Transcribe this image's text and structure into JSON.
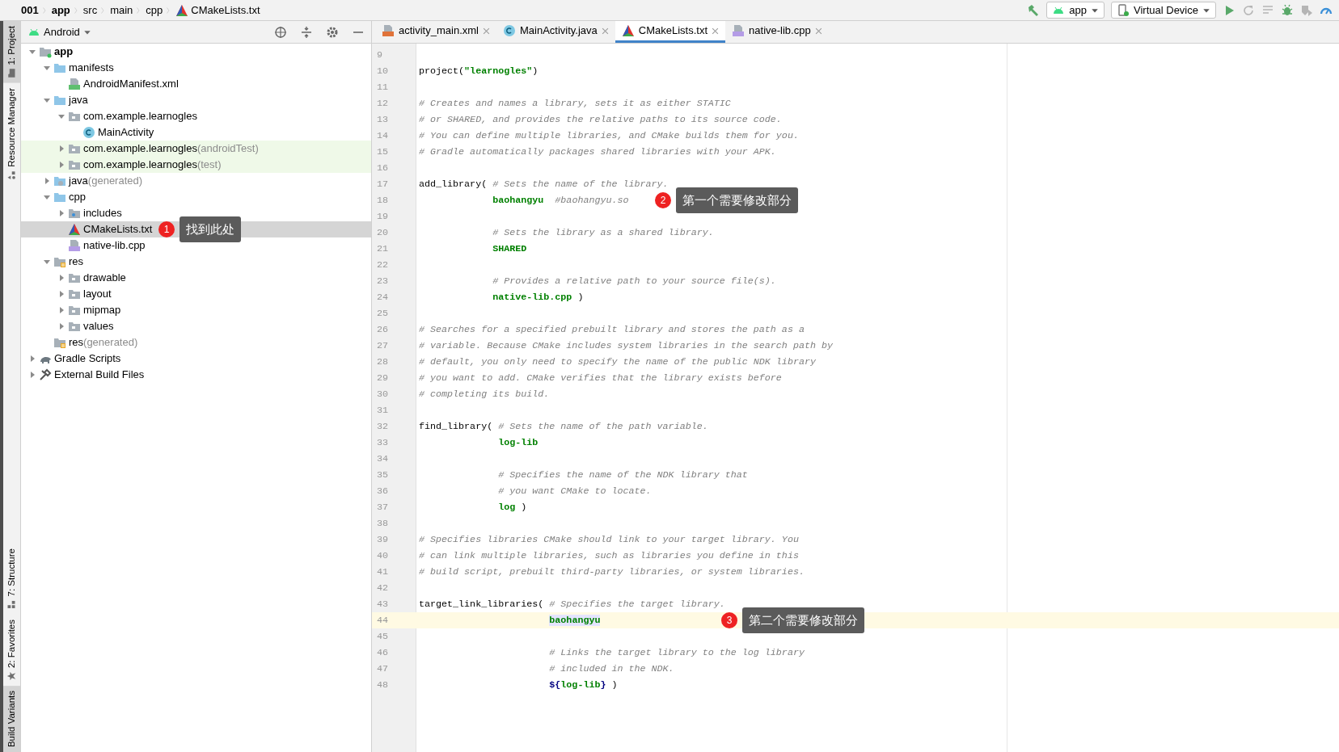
{
  "breadcrumbs": [
    {
      "text": "001",
      "kind": "project"
    },
    {
      "text": "app",
      "kind": "module"
    },
    {
      "text": "src",
      "kind": "folder"
    },
    {
      "text": "main",
      "kind": "folder"
    },
    {
      "text": "cpp",
      "kind": "folder"
    },
    {
      "text": "CMakeLists.txt",
      "kind": "cmake"
    }
  ],
  "toolbar": [
    {
      "kind": "hammer",
      "disabled": false
    },
    {
      "kind": "target",
      "label": "app"
    },
    {
      "kind": "device",
      "label": "Virtual Device"
    },
    {
      "kind": "run",
      "disabled": false
    },
    {
      "kind": "rerun",
      "disabled": true
    },
    {
      "kind": "list",
      "disabled": true
    },
    {
      "kind": "debug",
      "disabled": false
    },
    {
      "kind": "profile",
      "disabled": true
    },
    {
      "kind": "gauge",
      "disabled": false
    }
  ],
  "side_strip": {
    "top": [
      {
        "label": "1: Project",
        "selected": true
      },
      {
        "label": "Resource Manager",
        "selected": false
      }
    ],
    "bottom": [
      {
        "label": "7: Structure",
        "selected": false
      },
      {
        "label": "2: Favorites",
        "selected": false
      },
      {
        "label": "Build Variants",
        "selected": true
      }
    ]
  },
  "project_panel": {
    "view": "Android",
    "tree": [
      {
        "label": "app",
        "kind": "module",
        "expanded": true,
        "selected": false,
        "children": [
          {
            "label": "manifests",
            "kind": "folder",
            "expanded": true,
            "selected": false,
            "children": [
              {
                "label": "AndroidManifest.xml",
                "kind": "manifest",
                "selected": false
              }
            ]
          },
          {
            "label": "java",
            "kind": "folder",
            "expanded": true,
            "selected": false,
            "children": [
              {
                "label": "com.example.learnogles",
                "kind": "package",
                "expanded": true,
                "selected": false,
                "children": [
                  {
                    "label": "MainActivity",
                    "kind": "class",
                    "selected": false
                  }
                ]
              },
              {
                "label": "com.example.learnogles",
                "suffix": "(androidTest)",
                "kind": "package",
                "test": true,
                "expanded": false,
                "selected": false
              },
              {
                "label": "com.example.learnogles",
                "suffix": "(test)",
                "kind": "package",
                "test": true,
                "expanded": false,
                "selected": false
              }
            ]
          },
          {
            "label": "java",
            "suffix": "(generated)",
            "kind": "generated",
            "expanded": false,
            "selected": false
          },
          {
            "label": "cpp",
            "kind": "folder",
            "expanded": true,
            "selected": false,
            "children": [
              {
                "label": "includes",
                "kind": "includes",
                "expanded": false,
                "selected": false
              },
              {
                "label": "CMakeLists.txt",
                "kind": "cmake",
                "selected": true,
                "callout": {
                  "number": "1",
                  "text": "找到此处"
                }
              },
              {
                "label": "native-lib.cpp",
                "kind": "cpp",
                "selected": false
              }
            ]
          },
          {
            "label": "res",
            "kind": "res",
            "expanded": true,
            "selected": false,
            "children": [
              {
                "label": "drawable",
                "kind": "package",
                "expanded": false,
                "selected": false
              },
              {
                "label": "layout",
                "kind": "package",
                "expanded": false,
                "selected": false
              },
              {
                "label": "mipmap",
                "kind": "package",
                "expanded": false,
                "selected": false
              },
              {
                "label": "values",
                "kind": "package",
                "expanded": false,
                "selected": false
              }
            ]
          },
          {
            "label": "res",
            "suffix": "(generated)",
            "kind": "res",
            "selected": false
          }
        ]
      },
      {
        "label": "Gradle Scripts",
        "kind": "gradle",
        "expanded": false,
        "selected": false
      },
      {
        "label": "External Build Files",
        "kind": "tools",
        "expanded": false,
        "selected": false
      }
    ]
  },
  "editor_tabs": [
    {
      "label": "activity_main.xml",
      "kind": "xml",
      "selected": false
    },
    {
      "label": "MainActivity.java",
      "kind": "class",
      "selected": false
    },
    {
      "label": "CMakeLists.txt",
      "kind": "cmake",
      "selected": true
    },
    {
      "label": "native-lib.cpp",
      "kind": "cpp",
      "selected": false
    }
  ],
  "editor": {
    "lines": [
      {
        "number": "9",
        "current": false
      },
      {
        "number": "10",
        "current": false,
        "segments": [
          {
            "kind": "plain",
            "text": "project("
          },
          {
            "kind": "string",
            "text": "\"learnogles\""
          },
          {
            "kind": "plain",
            "text": ")"
          }
        ]
      },
      {
        "number": "11",
        "current": false
      },
      {
        "number": "12",
        "current": false,
        "segments": [
          {
            "kind": "comment",
            "text": "# Creates and names a library, sets it as either STATIC"
          }
        ]
      },
      {
        "number": "13",
        "current": false,
        "segments": [
          {
            "kind": "comment",
            "text": "# or SHARED, and provides the relative paths to its source code."
          }
        ]
      },
      {
        "number": "14",
        "current": false,
        "segments": [
          {
            "kind": "comment",
            "text": "# You can define multiple libraries, and CMake builds them for you."
          }
        ]
      },
      {
        "number": "15",
        "current": false,
        "segments": [
          {
            "kind": "comment",
            "text": "# Gradle automatically packages shared libraries with your APK."
          }
        ]
      },
      {
        "number": "16",
        "current": false
      },
      {
        "number": "17",
        "current": false,
        "segments": [
          {
            "kind": "plain",
            "text": "add_library( "
          },
          {
            "kind": "comment",
            "text": "# Sets the name of the library."
          }
        ]
      },
      {
        "number": "18",
        "current": false,
        "segments": [
          {
            "kind": "arg",
            "text": "             baohangyu"
          },
          {
            "kind": "comment",
            "text": "  #baohangyu.so"
          }
        ],
        "callout": {
          "number": "2",
          "text": "第一个需要修改部分"
        }
      },
      {
        "number": "19",
        "current": false
      },
      {
        "number": "20",
        "current": false,
        "segments": [
          {
            "kind": "comment",
            "text": "             # Sets the library as a shared library."
          }
        ]
      },
      {
        "number": "21",
        "current": false,
        "segments": [
          {
            "kind": "arg",
            "text": "             SHARED"
          }
        ]
      },
      {
        "number": "22",
        "current": false
      },
      {
        "number": "23",
        "current": false,
        "segments": [
          {
            "kind": "comment",
            "text": "             # Provides a relative path to your source file(s)."
          }
        ]
      },
      {
        "number": "24",
        "current": false,
        "segments": [
          {
            "kind": "arg",
            "text": "             native-lib.cpp"
          },
          {
            "kind": "plain",
            "text": " )"
          }
        ]
      },
      {
        "number": "25",
        "current": false
      },
      {
        "number": "26",
        "current": false,
        "segments": [
          {
            "kind": "comment",
            "text": "# Searches for a specified prebuilt library and stores the path as a"
          }
        ]
      },
      {
        "number": "27",
        "current": false,
        "segments": [
          {
            "kind": "comment",
            "text": "# variable. Because CMake includes system libraries in the search path by"
          }
        ]
      },
      {
        "number": "28",
        "current": false,
        "segments": [
          {
            "kind": "comment",
            "text": "# default, you only need to specify the name of the public NDK library"
          }
        ]
      },
      {
        "number": "29",
        "current": false,
        "segments": [
          {
            "kind": "comment",
            "text": "# you want to add. CMake verifies that the library exists before"
          }
        ]
      },
      {
        "number": "30",
        "current": false,
        "segments": [
          {
            "kind": "comment",
            "text": "# completing its build."
          }
        ]
      },
      {
        "number": "31",
        "current": false
      },
      {
        "number": "32",
        "current": false,
        "segments": [
          {
            "kind": "plain",
            "text": "find_library( "
          },
          {
            "kind": "comment",
            "text": "# Sets the name of the path variable."
          }
        ]
      },
      {
        "number": "33",
        "current": false,
        "segments": [
          {
            "kind": "arg",
            "text": "              log-lib"
          }
        ]
      },
      {
        "number": "34",
        "current": false
      },
      {
        "number": "35",
        "current": false,
        "segments": [
          {
            "kind": "comment",
            "text": "              # Specifies the name of the NDK library that"
          }
        ]
      },
      {
        "number": "36",
        "current": false,
        "segments": [
          {
            "kind": "comment",
            "text": "              # you want CMake to locate."
          }
        ]
      },
      {
        "number": "37",
        "current": false,
        "segments": [
          {
            "kind": "arg",
            "text": "              log"
          },
          {
            "kind": "plain",
            "text": " )"
          }
        ]
      },
      {
        "number": "38",
        "current": false
      },
      {
        "number": "39",
        "current": false,
        "segments": [
          {
            "kind": "comment",
            "text": "# Specifies libraries CMake should link to your target library. You"
          }
        ]
      },
      {
        "number": "40",
        "current": false,
        "segments": [
          {
            "kind": "comment",
            "text": "# can link multiple libraries, such as libraries you define in this"
          }
        ]
      },
      {
        "number": "41",
        "current": false,
        "segments": [
          {
            "kind": "comment",
            "text": "# build script, prebuilt third-party libraries, or system libraries."
          }
        ]
      },
      {
        "number": "42",
        "current": false
      },
      {
        "number": "43",
        "current": false,
        "segments": [
          {
            "kind": "plain",
            "text": "target_link_libraries( "
          },
          {
            "kind": "comment",
            "text": "# Specifies the target library."
          }
        ]
      },
      {
        "number": "44",
        "current": true,
        "segments": [
          {
            "kind": "match",
            "text": "                       baohangyu"
          }
        ],
        "callout": {
          "number": "3",
          "text": "第二个需要修改部分"
        }
      },
      {
        "number": "45",
        "current": false
      },
      {
        "number": "46",
        "current": false,
        "segments": [
          {
            "kind": "comment",
            "text": "                       # Links the target library to the log library"
          }
        ]
      },
      {
        "number": "47",
        "current": false,
        "segments": [
          {
            "kind": "comment",
            "text": "                       # included in the NDK."
          }
        ]
      },
      {
        "number": "48",
        "current": false,
        "segments": [
          {
            "kind": "var",
            "text": "                       ${"
          },
          {
            "kind": "arg",
            "text": "log-lib"
          },
          {
            "kind": "var",
            "text": "}"
          },
          {
            "kind": "plain",
            "text": " )"
          }
        ]
      }
    ]
  }
}
